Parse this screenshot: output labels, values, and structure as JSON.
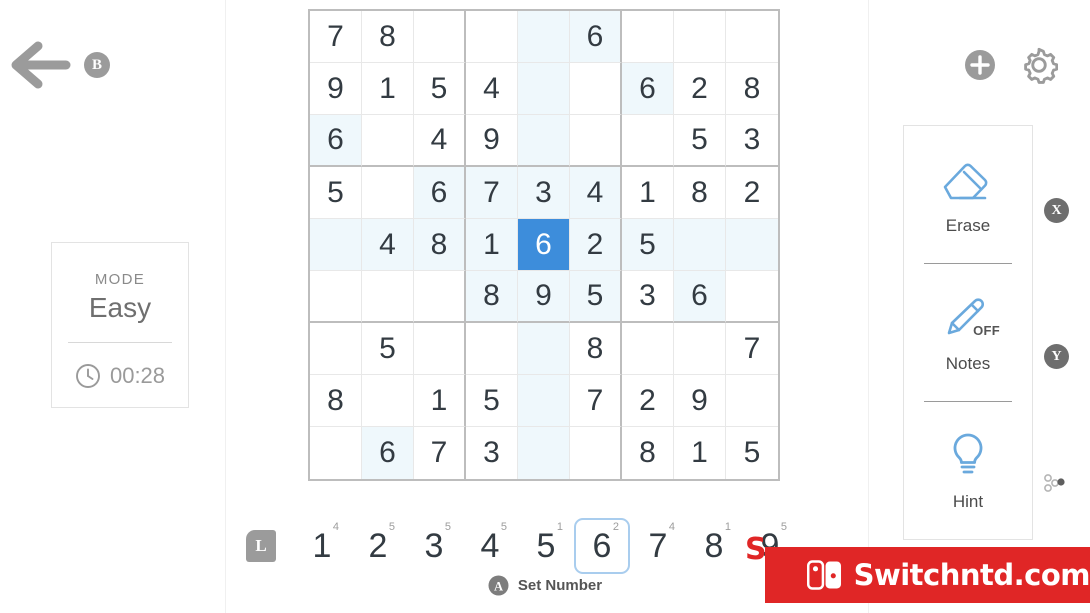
{
  "nav": {
    "back_icon": "back-arrow-icon",
    "back_button_badge": "B"
  },
  "top_right": {
    "add_icon": "plus-circle-icon",
    "settings_icon": "gear-icon"
  },
  "mode_panel": {
    "label": "MODE",
    "value": "Easy",
    "clock_icon": "clock-icon",
    "timer": "00:28"
  },
  "board": {
    "selected": {
      "row": 5,
      "col": 5,
      "value": "6"
    },
    "highlight_value": "6",
    "rows": [
      [
        "7",
        "8",
        "",
        "",
        "",
        "6",
        "",
        "",
        ""
      ],
      [
        "9",
        "1",
        "5",
        "4",
        "",
        "",
        "6",
        "2",
        "8"
      ],
      [
        "6",
        "",
        "4",
        "9",
        "",
        "",
        "",
        "5",
        "3"
      ],
      [
        "5",
        "",
        "6",
        "7",
        "3",
        "4",
        "1",
        "8",
        "2"
      ],
      [
        "",
        "4",
        "8",
        "1",
        "6",
        "2",
        "5",
        "",
        ""
      ],
      [
        "",
        "",
        "",
        "8",
        "9",
        "5",
        "3",
        "6",
        ""
      ],
      [
        "",
        "5",
        "",
        "",
        "",
        "8",
        "",
        "",
        "7"
      ],
      [
        "8",
        "",
        "1",
        "5",
        "",
        "7",
        "2",
        "9",
        ""
      ],
      [
        "",
        "6",
        "7",
        "3",
        "",
        "",
        "8",
        "1",
        "5"
      ]
    ]
  },
  "tools": {
    "items": [
      {
        "label": "Erase",
        "icon": "eraser-icon",
        "badge": "X"
      },
      {
        "label": "Notes",
        "icon": "pencil-icon",
        "badge": "Y",
        "state": "OFF"
      },
      {
        "label": "Hint",
        "icon": "lightbulb-icon",
        "badge": "stick-icon"
      }
    ]
  },
  "numpad": {
    "shoulder_button": "L",
    "keys": [
      {
        "num": "1",
        "count": "4"
      },
      {
        "num": "2",
        "count": "5"
      },
      {
        "num": "3",
        "count": "5"
      },
      {
        "num": "4",
        "count": "5"
      },
      {
        "num": "5",
        "count": "1"
      },
      {
        "num": "6",
        "count": "2"
      },
      {
        "num": "7",
        "count": "4"
      },
      {
        "num": "8",
        "count": "1"
      },
      {
        "num": "9",
        "count": "5"
      }
    ],
    "selected_key": "6"
  },
  "action_hint": {
    "badge": "A",
    "label": "Set Number"
  },
  "watermark": {
    "text": "Switchntd.com",
    "partial_text": "S",
    "color": "#e02626",
    "logo_icon": "nintendo-switch-icon"
  },
  "colors": {
    "selected_cell": "#3d8ddb",
    "highlight_cell": "#eff8fc",
    "accent_blue": "#6aa9dd",
    "grid_border": "#bdbdbd"
  }
}
